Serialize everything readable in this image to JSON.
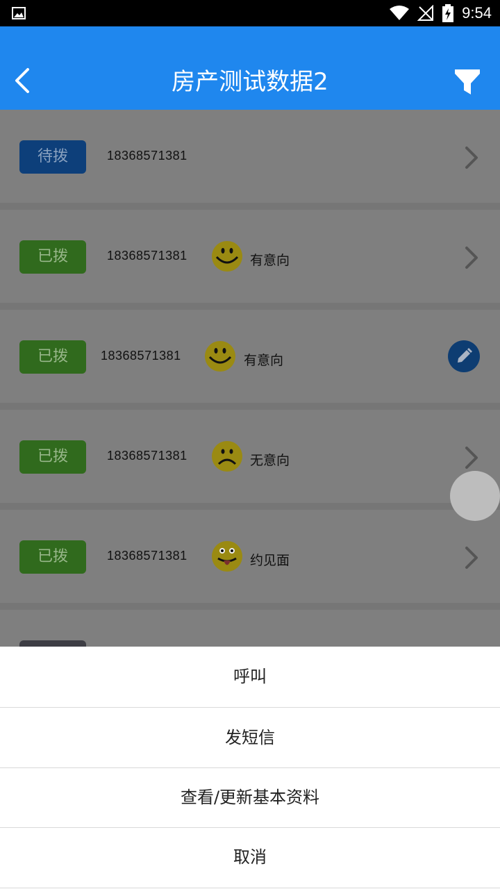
{
  "status_bar": {
    "time": "9:54"
  },
  "header": {
    "title": "房产测试数据2"
  },
  "rows": [
    {
      "status": "待拨",
      "phone": "18368571381",
      "intent": ""
    },
    {
      "status": "已拨",
      "phone": "18368571381",
      "intent": "有意向"
    },
    {
      "status": "已拨",
      "phone": "18368571381",
      "intent": "有意向"
    },
    {
      "status": "已拨",
      "phone": "18368571381",
      "intent": "无意向"
    },
    {
      "status": "已拨",
      "phone": "18368571381",
      "intent": "约见面"
    }
  ],
  "sheet": {
    "items": [
      "呼叫",
      "发短信",
      "查看/更新基本资料",
      "取消"
    ]
  },
  "colors": {
    "accent": "#1f87ee",
    "pending": "#0d5bb8",
    "dialed": "#57a836"
  }
}
